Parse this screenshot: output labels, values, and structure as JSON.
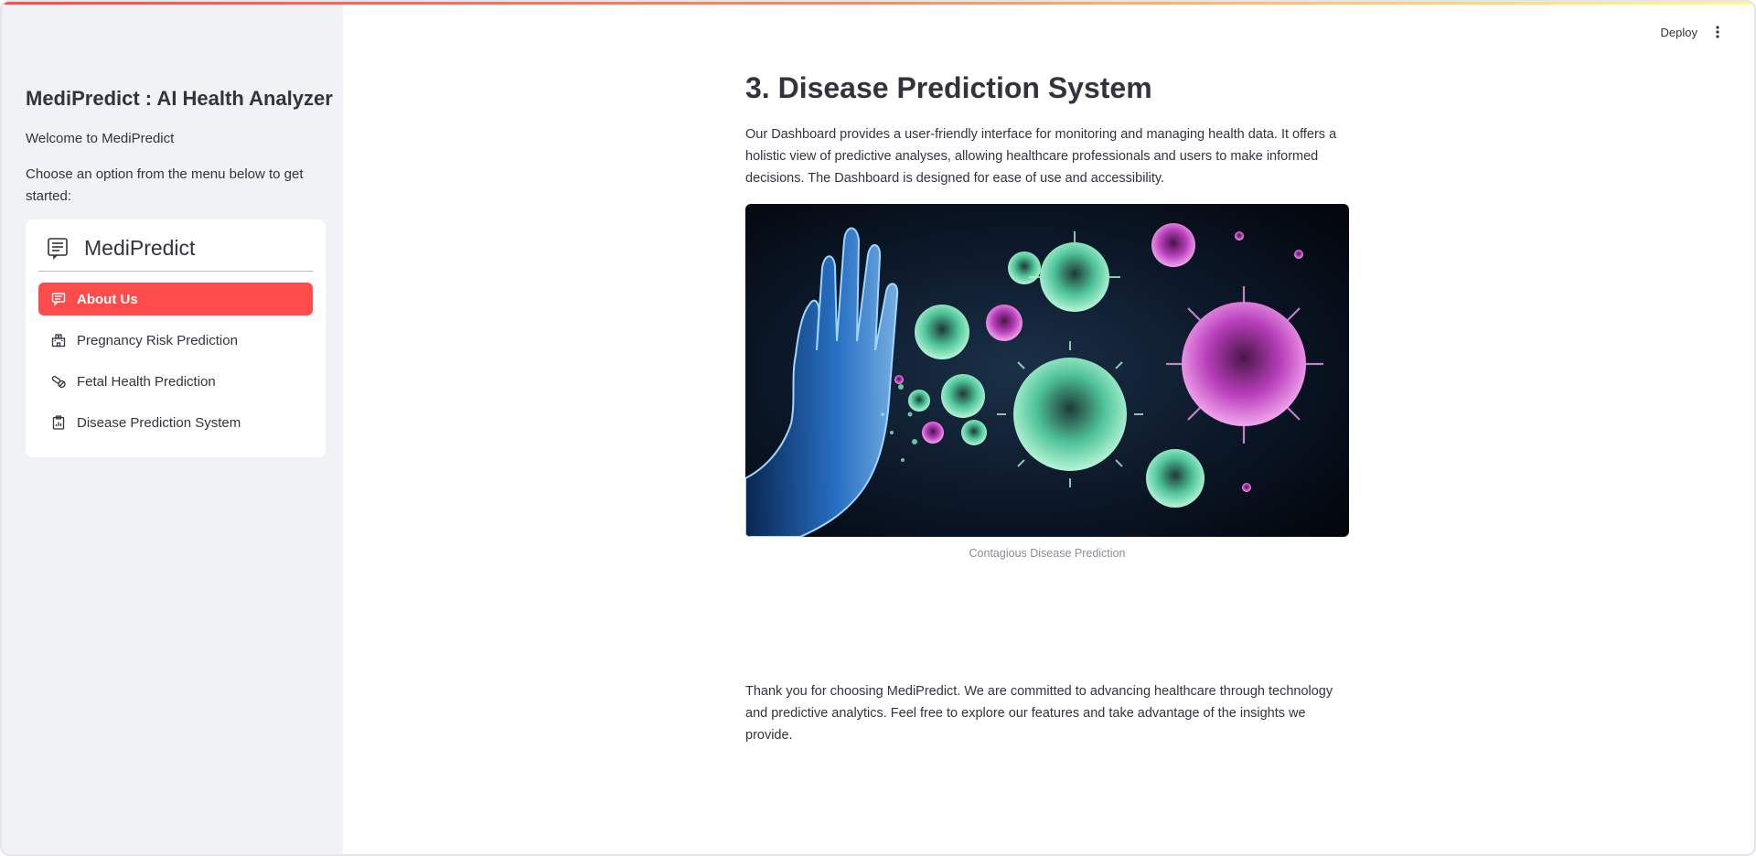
{
  "header": {
    "deploy_label": "Deploy",
    "menu_icon": "kebab-vertical-icon"
  },
  "sidebar": {
    "title": "MediPredict : AI Health Analyzer",
    "welcome": "Welcome to MediPredict",
    "instruction": "Choose an option from the menu below to get started:",
    "menu": {
      "title": "MediPredict",
      "title_icon": "document-list-icon",
      "items": [
        {
          "label": "About Us",
          "icon": "chat-icon",
          "active": true
        },
        {
          "label": "Pregnancy Risk Prediction",
          "icon": "hospital-icon",
          "active": false
        },
        {
          "label": "Fetal Health Prediction",
          "icon": "capsule-icon",
          "active": false
        },
        {
          "label": "Disease Prediction System",
          "icon": "clipboard-icon",
          "active": false
        }
      ]
    }
  },
  "main": {
    "title": "3. Disease Prediction System",
    "description": "Our Dashboard provides a user-friendly interface for monitoring and managing health data. It offers a holistic view of predictive analyses, allowing healthcare professionals and users to make informed decisions. The Dashboard is designed for ease of use and accessibility.",
    "image_caption": "Contagious Disease Prediction",
    "closing": "Thank you for choosing MediPredict. We are committed to advancing healthcare through technology and predictive analytics. Feel free to explore our features and take advantage of the insights we provide."
  },
  "colors": {
    "accent": "#ff4b4b",
    "sidebar_bg": "#f0f2f6",
    "text": "#31333f"
  }
}
